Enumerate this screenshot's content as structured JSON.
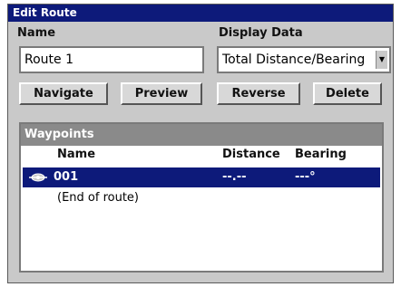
{
  "window": {
    "title": "Edit Route"
  },
  "name_field": {
    "label": "Name",
    "value": "Route 1"
  },
  "display_data": {
    "label": "Display Data",
    "selected": "Total Distance/Bearing"
  },
  "buttons": {
    "navigate": "Navigate",
    "preview": "Preview",
    "reverse": "Reverse",
    "delete": "Delete"
  },
  "waypoints": {
    "header": "Waypoints",
    "columns": {
      "name": "Name",
      "distance": "Distance",
      "bearing": "Bearing"
    },
    "rows": [
      {
        "name": "001",
        "distance": "--.--",
        "bearing": "---°",
        "selected": true
      },
      {
        "name": "(End of route)",
        "distance": "",
        "bearing": ""
      }
    ]
  },
  "colors": {
    "titlebar": "#0d1a7a",
    "selection": "#0d1a7a",
    "panel_header": "#8a8a8a",
    "background": "#c9c9c9"
  }
}
